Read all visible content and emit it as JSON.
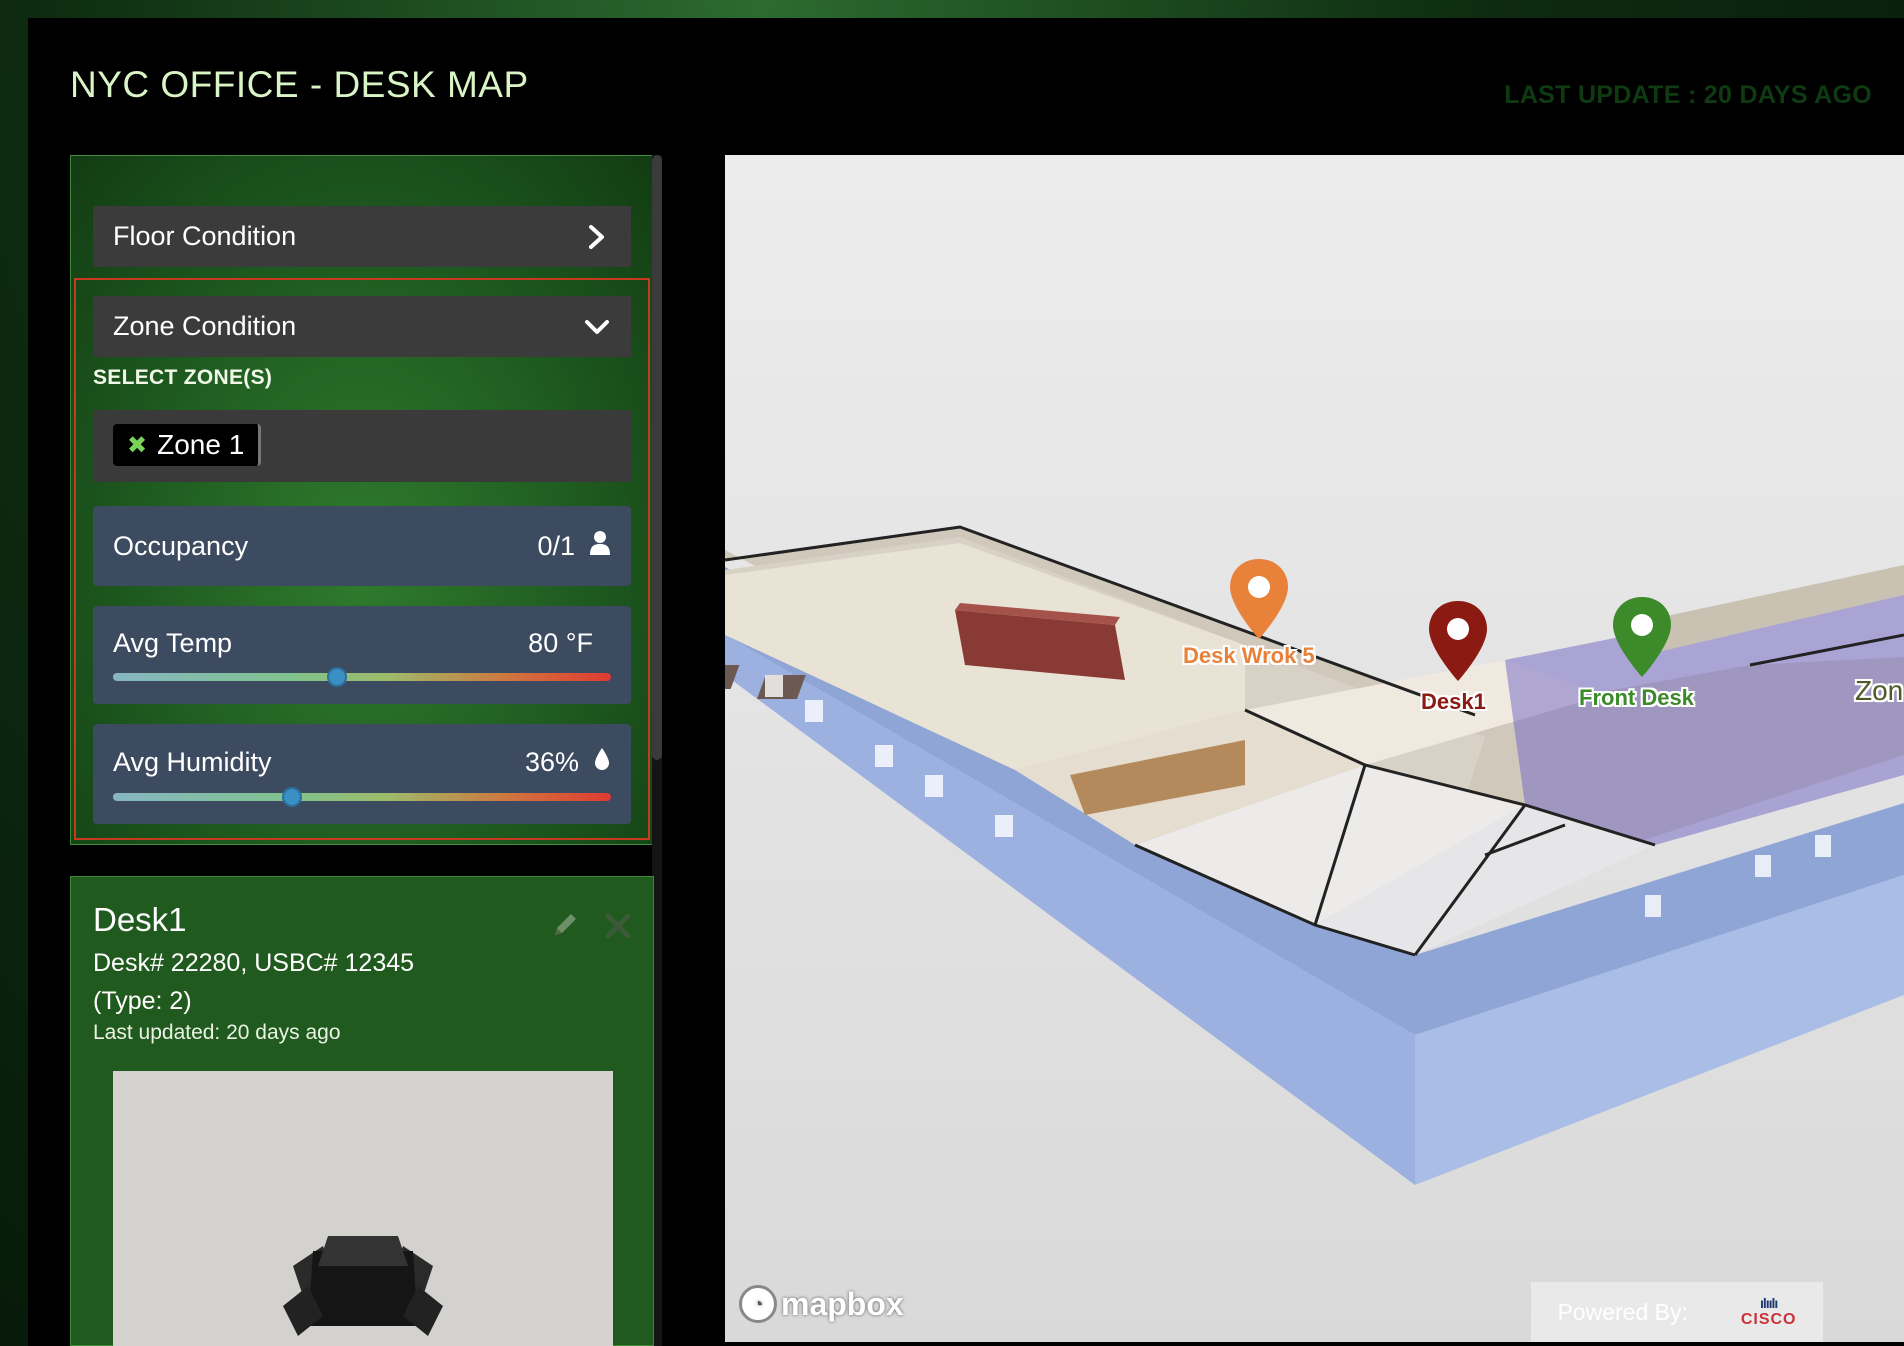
{
  "header": {
    "title": "NYC OFFICE - DESK MAP",
    "last_update": "LAST UPDATE : 20 DAYS AGO"
  },
  "sidebar": {
    "floor_condition": {
      "label": "Floor Condition",
      "icon": "chevron-right-icon"
    },
    "zone_condition": {
      "label": "Zone Condition",
      "icon": "chevron-down-icon",
      "select_label": "SELECT ZONE(S)",
      "selected_zones": [
        "Zone 1"
      ]
    },
    "metrics": {
      "occupancy": {
        "label": "Occupancy",
        "value": "0/1",
        "icon": "person-icon"
      },
      "avg_temp": {
        "label": "Avg Temp",
        "value": "80 °F",
        "slider_level": 0.45
      },
      "avg_humidity": {
        "label": "Avg Humidity",
        "value": "36%",
        "icon": "droplet-icon",
        "slider_level": 0.36
      }
    }
  },
  "desk_card": {
    "title": "Desk1",
    "line1": "Desk# 22280, USBC# 12345",
    "line2": "(Type: 2)",
    "line3": "Last updated: 20 days ago",
    "edit_icon": "pencil-icon",
    "close_icon": "close-icon"
  },
  "map": {
    "pins": [
      {
        "label": "Desk Wrok 5",
        "color": "#e8823a"
      },
      {
        "label": "Desk1",
        "color": "#8b1a12"
      },
      {
        "label": "Front Desk",
        "color": "#3c8a2a"
      },
      {
        "label": "Zon",
        "color": "#4d5a2a"
      }
    ],
    "attribution": "mapbox",
    "powered_by": "Powered By:",
    "powered_brand": "CISCO"
  },
  "colors": {
    "accent_green": "#215a1e",
    "zone_border": "#c63a1f",
    "metric_bg": "#3c4b60"
  }
}
